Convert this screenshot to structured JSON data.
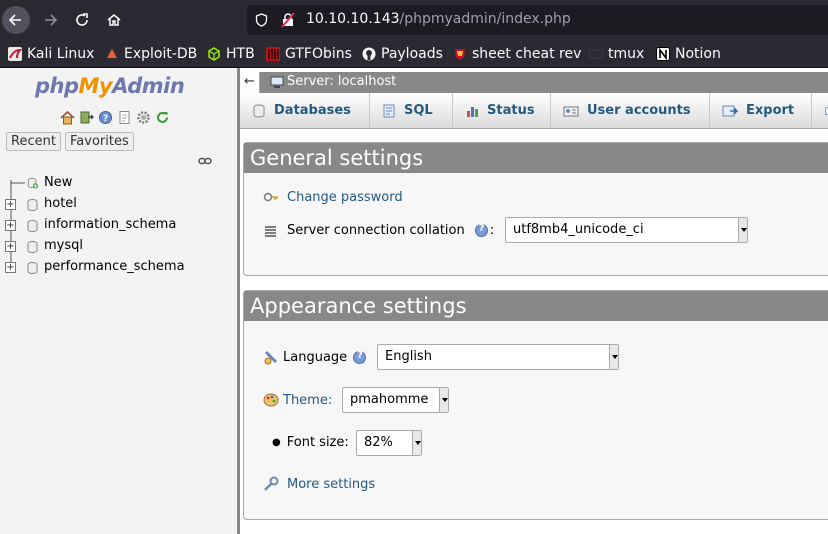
{
  "browser": {
    "url_host": "10.10.10.143",
    "url_path": "/phpmyadmin/index.php",
    "bookmarks": [
      {
        "label": "Kali Linux",
        "icon": "kali-dragon-icon"
      },
      {
        "label": "Exploit-DB",
        "icon": "exploit-db-icon"
      },
      {
        "label": "HTB",
        "icon": "htb-cube-icon"
      },
      {
        "label": "GTFObins",
        "icon": "gtfobins-icon"
      },
      {
        "label": "Payloads",
        "icon": "github-icon"
      },
      {
        "label": "sheet cheat rev",
        "icon": "ironman-icon"
      },
      {
        "label": "tmux",
        "icon": "tmux-icon"
      },
      {
        "label": "Notion",
        "icon": "notion-icon"
      }
    ]
  },
  "nav": {
    "logo": {
      "php": "php",
      "my": "My",
      "admin": "Admin"
    },
    "tabs": {
      "recent": "Recent",
      "favorites": "Favorites"
    },
    "tree": [
      {
        "label": "New"
      },
      {
        "label": "hotel"
      },
      {
        "label": "information_schema"
      },
      {
        "label": "mysql"
      },
      {
        "label": "performance_schema"
      }
    ]
  },
  "main": {
    "server_label": "Server: localhost",
    "tabs": [
      "Databases",
      "SQL",
      "Status",
      "User accounts",
      "Export"
    ],
    "general": {
      "title": "General settings",
      "change_password": "Change password",
      "collation_label": "Server connection collation",
      "collation_value": "utf8mb4_unicode_ci"
    },
    "appearance": {
      "title": "Appearance settings",
      "language_label": "Language",
      "language_value": "English",
      "theme_label": "Theme:",
      "theme_value": "pmahomme",
      "font_size_label": "Font size:",
      "font_size_value": "82%",
      "more_settings": "More settings"
    }
  },
  "colors": {
    "accent": "#235a81",
    "header_gray": "#888888",
    "browser_bg": "#2b2a33"
  }
}
